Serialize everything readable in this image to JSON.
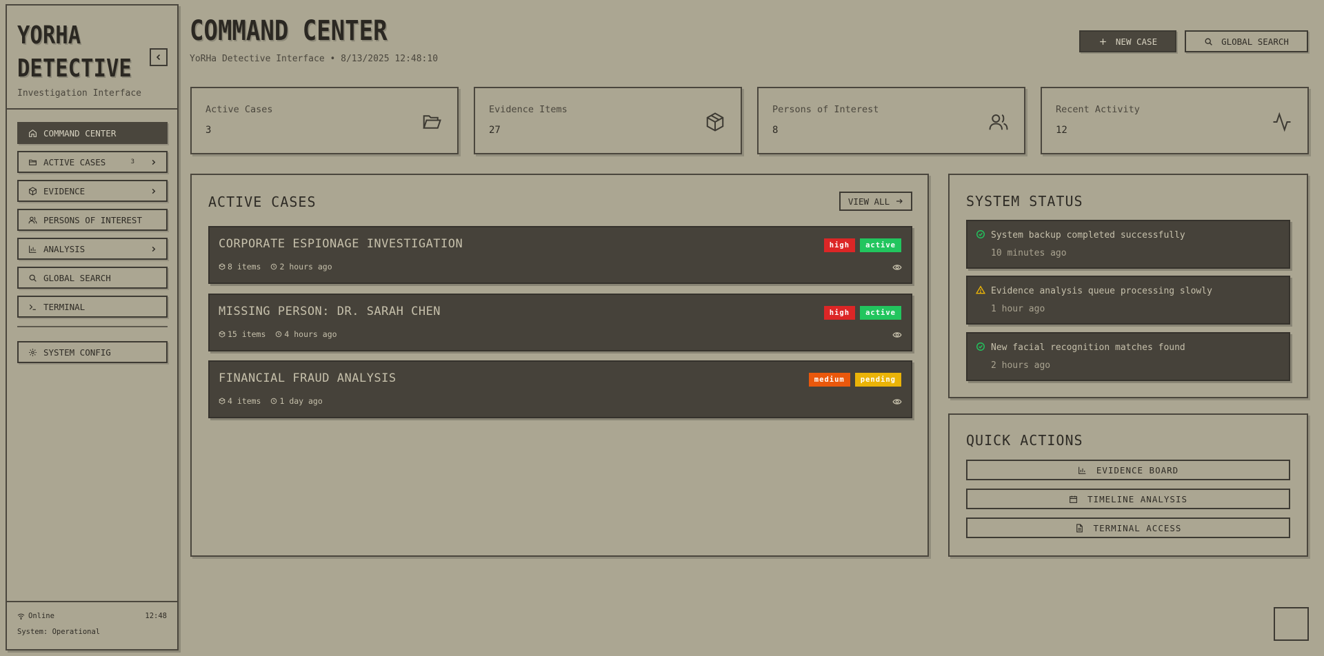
{
  "brand": {
    "title_line1": "YORHA",
    "title_line2": "DETECTIVE",
    "subtitle": "Investigation Interface"
  },
  "nav": {
    "items": [
      {
        "label": "COMMAND CENTER",
        "icon": "home-icon",
        "active": true
      },
      {
        "label": "ACTIVE CASES",
        "icon": "folder-icon",
        "badge": "3",
        "has_submenu": true
      },
      {
        "label": "EVIDENCE",
        "icon": "box-icon",
        "has_submenu": true
      },
      {
        "label": "PERSONS OF INTEREST",
        "icon": "users-icon"
      },
      {
        "label": "ANALYSIS",
        "icon": "bar-chart-icon",
        "has_submenu": true
      },
      {
        "label": "GLOBAL SEARCH",
        "icon": "search-icon"
      },
      {
        "label": "TERMINAL",
        "icon": "terminal-icon"
      }
    ],
    "config": {
      "label": "SYSTEM CONFIG",
      "icon": "gear-icon"
    }
  },
  "footer": {
    "connection": "Online",
    "time": "12:48",
    "system_status": "System: Operational"
  },
  "header": {
    "title": "COMMAND CENTER",
    "subtitle": "YoRHa Detective Interface • 8/13/2025 12:48:10",
    "new_case_label": "NEW CASE",
    "global_search_label": "GLOBAL SEARCH"
  },
  "stats": [
    {
      "label": "Active Cases",
      "value": "3",
      "icon": "folder-open-icon"
    },
    {
      "label": "Evidence Items",
      "value": "27",
      "icon": "box-icon"
    },
    {
      "label": "Persons of Interest",
      "value": "8",
      "icon": "users-icon"
    },
    {
      "label": "Recent Activity",
      "value": "12",
      "icon": "activity-icon"
    }
  ],
  "active_cases": {
    "title": "ACTIVE CASES",
    "view_all_label": "VIEW ALL",
    "cases": [
      {
        "title": "CORPORATE ESPIONAGE INVESTIGATION",
        "priority": "high",
        "status": "active",
        "items": "8 items",
        "time": "2 hours ago"
      },
      {
        "title": "MISSING PERSON: DR. SARAH CHEN",
        "priority": "high",
        "status": "active",
        "items": "15 items",
        "time": "4 hours ago"
      },
      {
        "title": "FINANCIAL FRAUD ANALYSIS",
        "priority": "medium",
        "status": "pending",
        "items": "4 items",
        "time": "1 day ago"
      }
    ]
  },
  "system_status": {
    "title": "SYSTEM STATUS",
    "items": [
      {
        "message": "System backup completed successfully",
        "time": "10 minutes ago",
        "icon": "check-circle-icon"
      },
      {
        "message": "Evidence analysis queue processing slowly",
        "time": "1 hour ago",
        "icon": "warning-triangle-icon"
      },
      {
        "message": "New facial recognition matches found",
        "time": "2 hours ago",
        "icon": "check-circle-icon"
      }
    ]
  },
  "quick_actions": {
    "title": "QUICK ACTIONS",
    "items": [
      {
        "label": "EVIDENCE BOARD",
        "icon": "bar-chart-icon"
      },
      {
        "label": "TIMELINE ANALYSIS",
        "icon": "calendar-icon"
      },
      {
        "label": "TERMINAL ACCESS",
        "icon": "document-icon"
      }
    ]
  },
  "colors": {
    "background": "#aba692",
    "dark_surface": "#46423a",
    "tag_high": "#dc2626",
    "tag_medium": "#ea580c",
    "tag_active": "#22c55e",
    "tag_pending": "#eab308",
    "status_ok": "#22c55e",
    "status_warn": "#eab308"
  }
}
